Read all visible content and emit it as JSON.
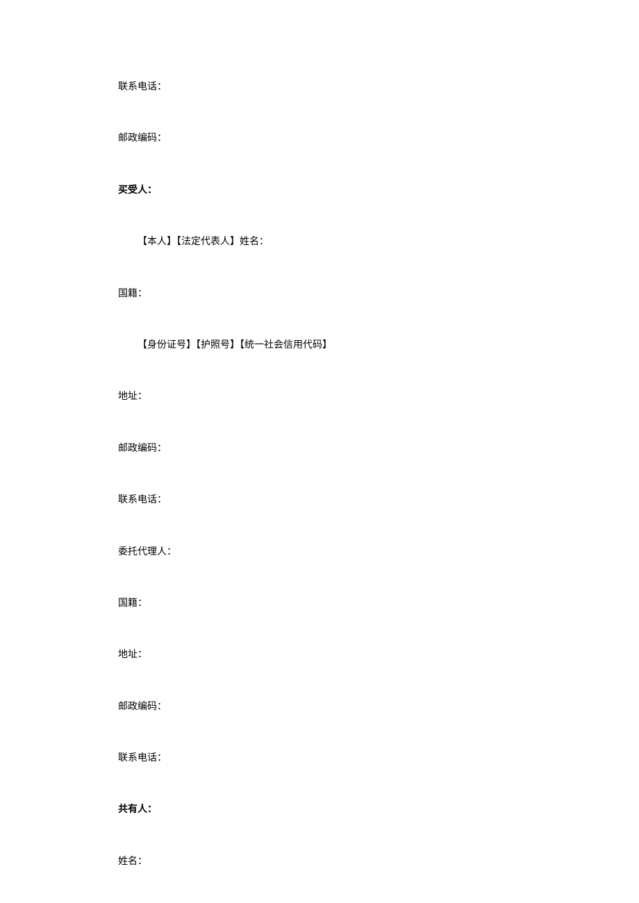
{
  "fields": {
    "contact_phone_1": "联系电话：",
    "postal_code_1": "邮政编码：",
    "buyer_heading": "买受人：",
    "buyer_name_label": "【本人】【法定代表人】姓名：",
    "nationality_1": "国籍：",
    "id_label": "【身份证号】【护照号】【统一社会信用代码】",
    "address_1": "地址：",
    "postal_code_2": "邮政编码：",
    "contact_phone_2": "联系电话：",
    "agent": "委托代理人：",
    "nationality_2": "国籍：",
    "address_2": "地址：",
    "postal_code_3": "邮政编码：",
    "contact_phone_3": "联系电话：",
    "coowner_heading": "共有人：",
    "name": "姓名："
  }
}
